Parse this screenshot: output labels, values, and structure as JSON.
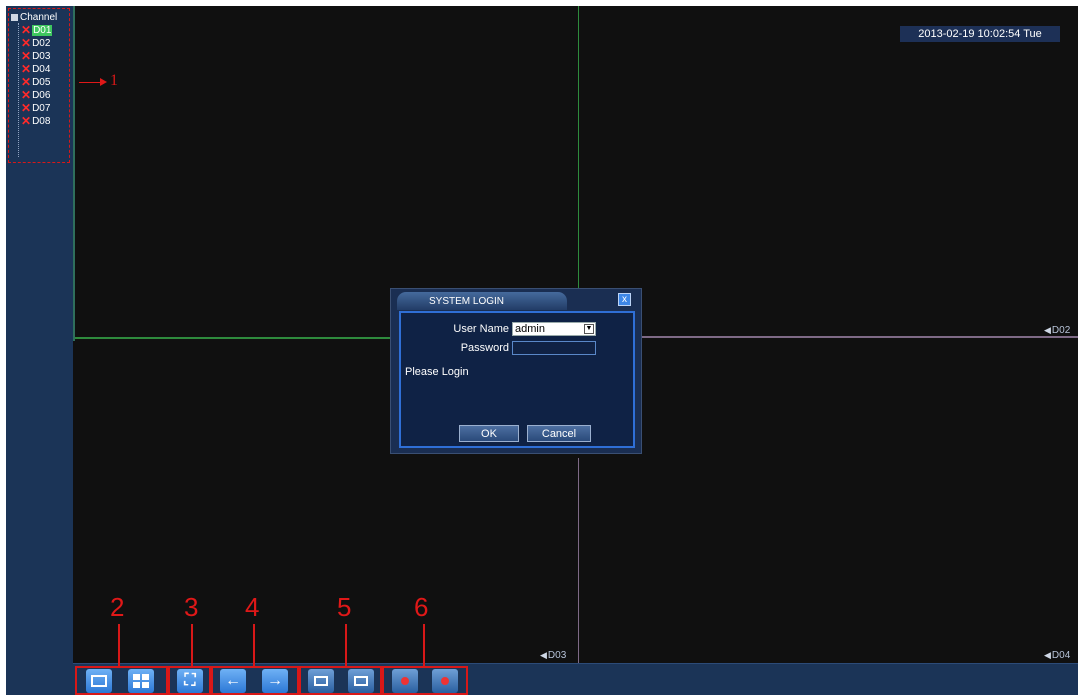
{
  "sidebar": {
    "tree_title": "Channel",
    "channels": [
      "D01",
      "D02",
      "D03",
      "D04",
      "D05",
      "D06",
      "D07",
      "D08"
    ],
    "selected": "D01"
  },
  "annotations": [
    "1",
    "2",
    "3",
    "4",
    "5",
    "6"
  ],
  "datetime": "2013-02-19 10:02:54 Tue",
  "channel_labels": {
    "d02": "D02",
    "d03": "D03",
    "d04": "D04"
  },
  "dialog": {
    "title": "SYSTEM LOGIN",
    "close_glyph": "x",
    "user_label": "User Name",
    "user_value": "admin",
    "password_label": "Password",
    "password_value": "",
    "status": "Please Login",
    "ok": "OK",
    "cancel": "Cancel"
  },
  "toolbar": {
    "icons": [
      "single-view-icon",
      "quad-view-icon",
      "fullscreen-icon",
      "previous-icon",
      "next-icon",
      "record-start-icon",
      "record-stop-icon",
      "record-mode-icon",
      "record-delete-icon"
    ]
  },
  "colors": {
    "annotation_red": "#d81818",
    "accent_blue": "#2f6fd6",
    "panel_navy": "#1b3457"
  }
}
